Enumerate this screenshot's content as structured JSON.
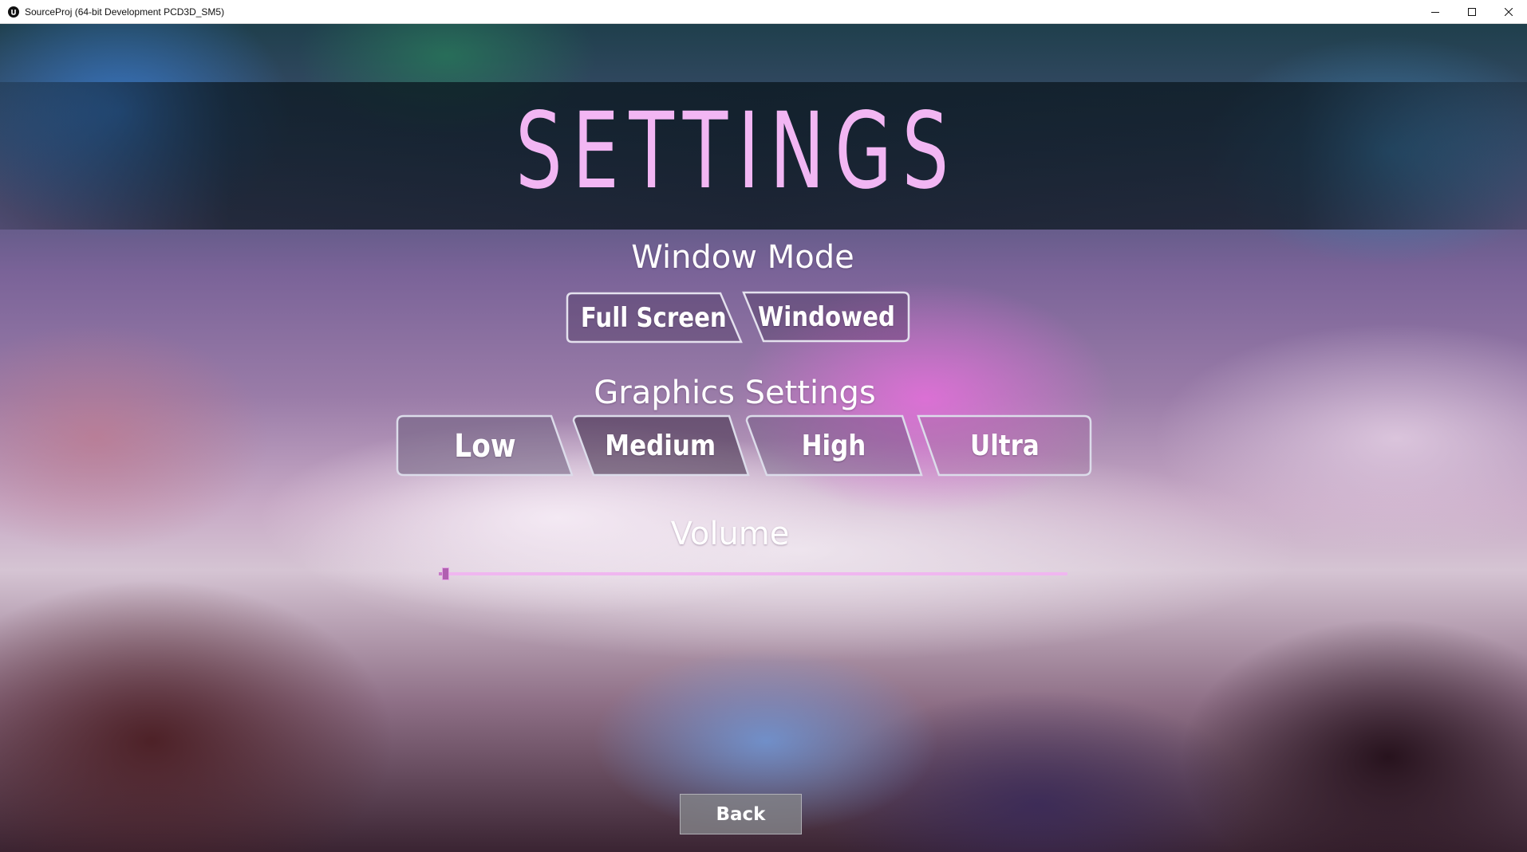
{
  "window": {
    "title": "SourceProj (64-bit Development PCD3D_SM5)"
  },
  "icons": {
    "app": "unreal-engine-icon",
    "minimize": "minimize-icon",
    "maximize": "maximize-icon",
    "close": "close-icon"
  },
  "menu": {
    "title": "SETTINGS",
    "window_mode": {
      "heading": "Window Mode",
      "options": [
        "Full Screen",
        "Windowed"
      ]
    },
    "graphics": {
      "heading": "Graphics Settings",
      "options": [
        "Low",
        "Medium",
        "High",
        "Ultra"
      ],
      "highlighted": "Low"
    },
    "volume": {
      "heading": "Volume",
      "level": 0.005
    },
    "back_label": "Back"
  },
  "colors": {
    "title_accent": "#f2b6f3",
    "slider_track": "#f0b6f0",
    "slider_handle": "#b060b0",
    "button_fill": "#3c2a46",
    "button_border": "#dcdcea"
  }
}
